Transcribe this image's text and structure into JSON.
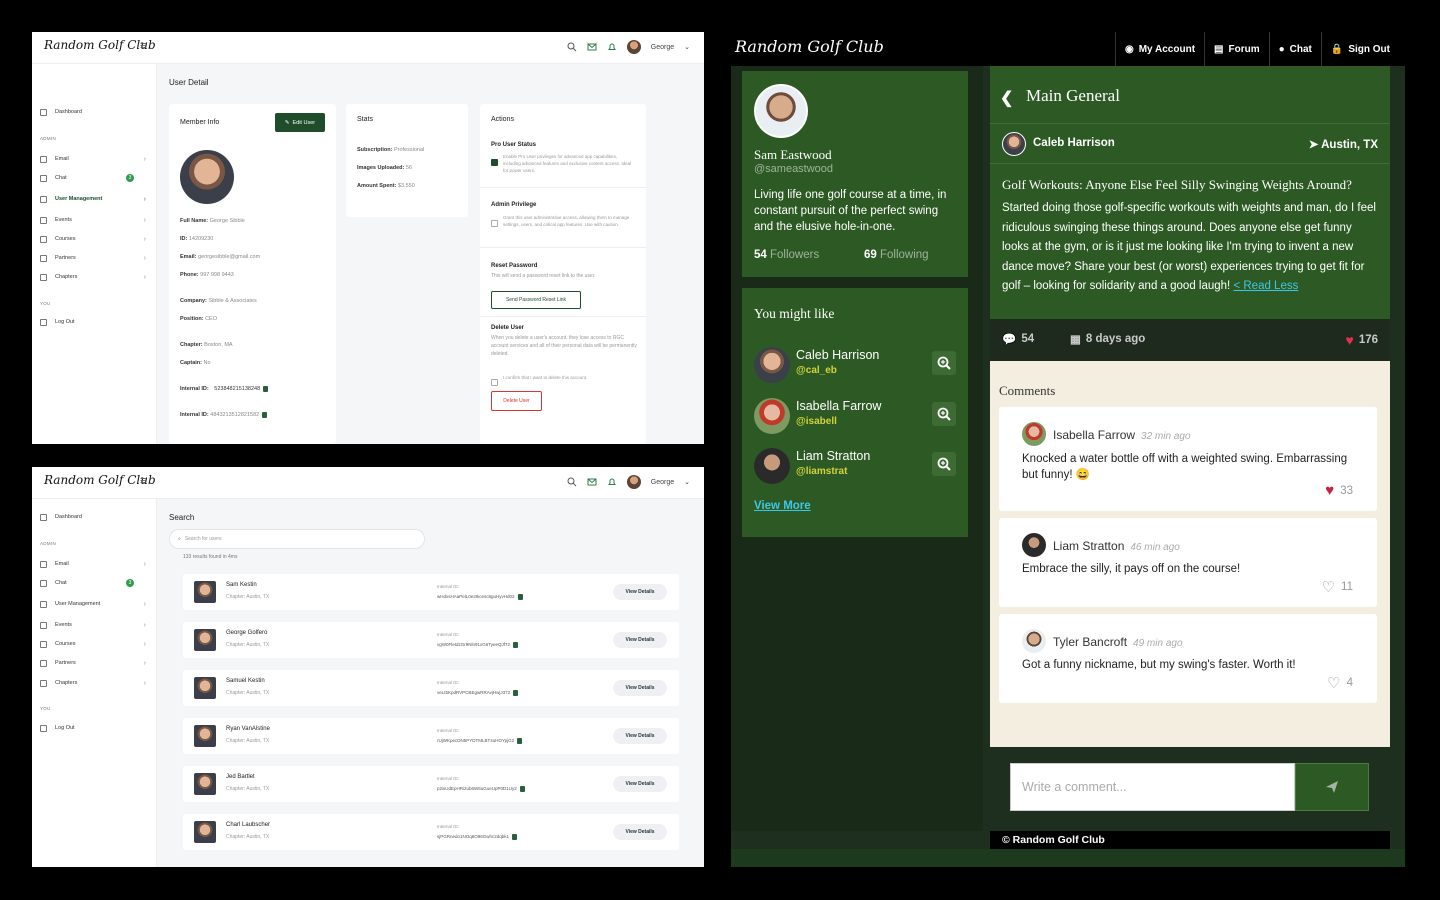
{
  "brand": "Random Golf Club",
  "admin_common": {
    "user": "George",
    "sidebar": {
      "dashboard": "Dashboard",
      "section_admin": "ADMIN",
      "section_you": "YOU",
      "items": [
        {
          "label": "Email"
        },
        {
          "label": "Chat",
          "badge": "3"
        },
        {
          "label": "User Management"
        },
        {
          "label": "Events"
        },
        {
          "label": "Courses"
        },
        {
          "label": "Partners"
        },
        {
          "label": "Chapters"
        }
      ],
      "logout": "Log Out"
    }
  },
  "user_detail": {
    "page_title": "User Detail",
    "member_info": {
      "title": "Member Info",
      "edit_button": "Edit User",
      "fields": [
        {
          "label": "Full Name:",
          "value": "George Sibble"
        },
        {
          "label": "ID:",
          "value": "14209230"
        },
        {
          "label": "Email:",
          "value": "georgesibble@gmail.com"
        },
        {
          "label": "Phone:",
          "value": "997 998 9443"
        },
        {
          "label": "Company:",
          "value": "Sibble & Associates"
        },
        {
          "label": "Position:",
          "value": "CEO"
        },
        {
          "label": "Chapter:",
          "value": "Boston, MA"
        },
        {
          "label": "Captain:",
          "value": "No"
        }
      ],
      "internal_ids": [
        {
          "label": "Internal ID:",
          "value": "523848215138248"
        },
        {
          "label": "Internal ID:",
          "value": "4843213512821582"
        }
      ]
    },
    "stats": {
      "title": "Stats",
      "items": [
        {
          "label": "Subscription:",
          "value": "Professional"
        },
        {
          "label": "Images Uploaded:",
          "value": "56"
        },
        {
          "label": "Amount Spent:",
          "value": "$3,550"
        }
      ]
    },
    "actions": {
      "title": "Actions",
      "pro_title": "Pro User Status",
      "pro_text": "Enable Pro User privileges for advanced app capabilities, including advanced features and exclusive content access. Ideal for power users.",
      "admin_title": "Admin Privilege",
      "admin_text": "Grant this user administrative access, allowing them to manage settings, users, and critical app features. Use with caution.",
      "reset_title": "Reset Password",
      "reset_text": "This will send a password reset link to the user.",
      "reset_button": "Send Password Reset Link",
      "delete_title": "Delete User",
      "delete_text": "When you delete a user's account, they lose access to RGC account services and all of their personal data will be permanently deleted.",
      "delete_confirm": "I confirm that I want to delete this account.",
      "delete_button": "Delete User"
    }
  },
  "search_page": {
    "title": "Search",
    "placeholder": "Search for users",
    "results_text": "133 results found in 4ms",
    "internal_label": "Internal ID:",
    "view_label": "View Details",
    "results": [
      {
        "name": "Sam Kestin",
        "chapter": "Chapter: Austin, TX",
        "internal_id": "wHdxsHAaPelL0e3Ikcesc8guHyvHd02"
      },
      {
        "name": "George Golfero",
        "chapter": "Chapter: Austin, TX",
        "internal_id": "vgW0FletdzGr9Nln91xG6TyeeQJf72"
      },
      {
        "name": "Samuel Kestin",
        "chapter": "Chapter: Austin, TX",
        "internal_id": "veLt5KpdRVPCBEgwRRAvjHwjJ372"
      },
      {
        "name": "Ryan VanAlstine",
        "chapter": "Chapter: Austin, TX",
        "internal_id": "rUjWKpecDN5PYDTMLBT4uHOYpjG2"
      },
      {
        "name": "Jed Bartlet",
        "chapter": "Chapter: Austin, TX",
        "internal_id": "p2xiUdEpHRi2ub6W6uGueUpP0D1Uy2"
      },
      {
        "name": "Charl Laubscher",
        "chapter": "Chapter: Austin, TX",
        "internal_id": "sjPGRnedo1NOq6O96Gwhc2dqbk1"
      }
    ]
  },
  "forum": {
    "nav": [
      "My Account",
      "Forum",
      "Chat",
      "Sign Out"
    ],
    "profile": {
      "name": "Sam Eastwood",
      "handle": "@sameastwood",
      "bio": "Living life one golf course at a time, in constant pursuit of the perfect swing and the elusive hole-in-one.",
      "followers_count": "54",
      "followers_label": "Followers",
      "following_count": "69",
      "following_label": "Following"
    },
    "suggestions": {
      "title": "You might like",
      "people": [
        {
          "name": "Caleb Harrison",
          "handle": "@cal_eb"
        },
        {
          "name": "Isabella Farrow",
          "handle": "@isabell"
        },
        {
          "name": "Liam Stratton",
          "handle": "@liamstrat"
        }
      ],
      "view_more": "View More"
    },
    "thread": {
      "category": "Main General",
      "author": "Caleb Harrison",
      "location": "Austin, TX",
      "title": "Golf Workouts: Anyone Else Feel Silly Swinging Weights Around?",
      "body": "Started doing those golf-specific workouts with weights and man, do I feel ridiculous swinging these things around. Does anyone else get funny looks at the gym, or is it just me looking like I'm trying to invent a new dance move? Share your best (or worst) experiences trying to get fit for golf – looking for solidarity and a good laugh!",
      "read_less": "< Read Less",
      "comment_count": "54",
      "age": "8 days ago",
      "likes": "176"
    },
    "comments_title": "Comments",
    "comments": [
      {
        "name": "Isabella Farrow",
        "time": "32 min ago",
        "text": "Knocked a water bottle off with a weighted swing. Embarrassing but funny! 😄",
        "likes": "33",
        "liked": true
      },
      {
        "name": "Liam Stratton",
        "time": "46 min ago",
        "text": "Embrace the silly, it pays off on the course!",
        "likes": "11",
        "liked": false
      },
      {
        "name": "Tyler Bancroft",
        "time": "49 min ago",
        "text": "Got a funny nickname, but my swing's faster. Worth it!",
        "likes": "4",
        "liked": false
      }
    ],
    "compose_placeholder": "Write a comment...",
    "copyright": "© Random Golf Club"
  },
  "colors": {
    "brand_green": "#2d5a24",
    "admin_green": "#1f4d2b",
    "link_cyan": "#3dc7e6",
    "handle_yellow": "#d3d33a",
    "heart_red": "#e0314f"
  }
}
